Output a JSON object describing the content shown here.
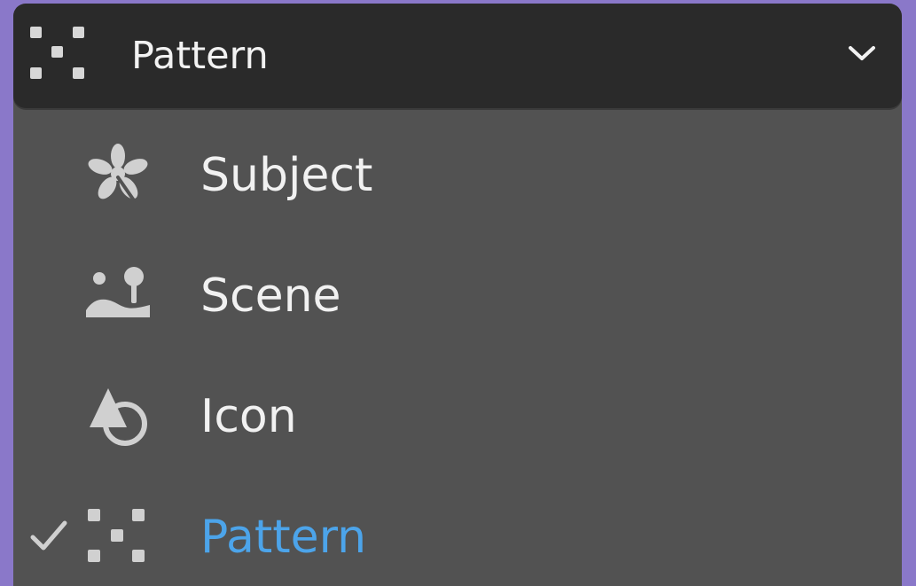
{
  "dropdown": {
    "selected_label": "Pattern",
    "options": [
      {
        "label": "Subject",
        "icon": "subject-icon",
        "selected": false
      },
      {
        "label": "Scene",
        "icon": "scene-icon",
        "selected": false
      },
      {
        "label": "Icon",
        "icon": "icon-icon",
        "selected": false
      },
      {
        "label": "Pattern",
        "icon": "pattern-icon",
        "selected": true
      }
    ]
  },
  "colors": {
    "background": "#8a78c9",
    "header": "#2a2a2a",
    "menu": "#525252",
    "text": "#f1f1f1",
    "selected_text": "#4ca4ea",
    "icon": "#d0d0d0"
  }
}
